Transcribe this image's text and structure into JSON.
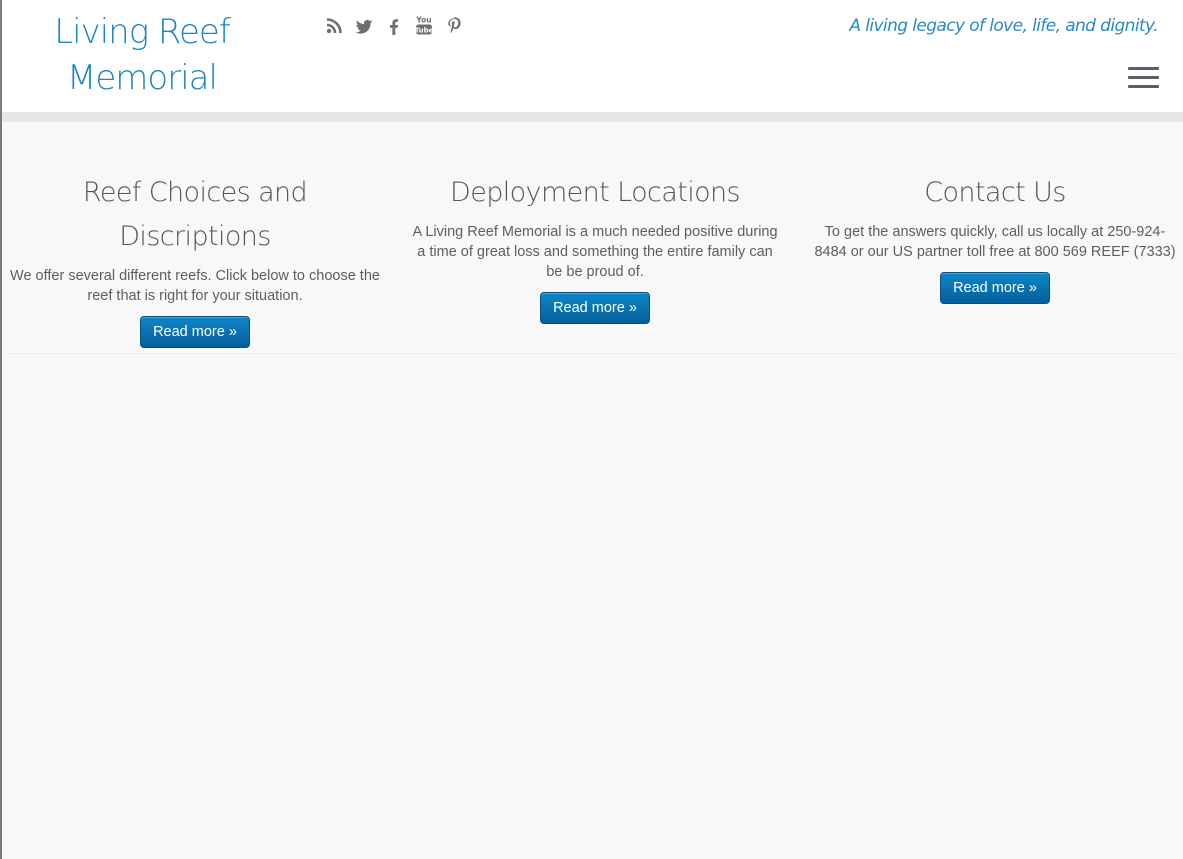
{
  "site": {
    "logo": "Living Reef Memorial",
    "tagline": "A living legacy of love, life, and dignity."
  },
  "social": [
    {
      "name": "rss-icon"
    },
    {
      "name": "twitter-icon"
    },
    {
      "name": "facebook-icon"
    },
    {
      "name": "youtube-icon"
    },
    {
      "name": "pinterest-icon"
    }
  ],
  "colors": {
    "brand_blue": "#1e84c4",
    "button": "#0a6fad",
    "background": "#f8f8f8"
  },
  "featured": [
    {
      "title": "Reef Choices and Discriptions",
      "text": "We offer several different reefs. Click below to choose the reef that is right for your situation.",
      "button": "Read more »"
    },
    {
      "title": "Deployment Locations",
      "text": "A Living Reef Memorial is a much needed positive during a time of great loss and something the entire family can be be proud of.",
      "button": "Read more »"
    },
    {
      "title": "Contact Us",
      "text": "To get the answers quickly, call us locally at 250-924-8484 or our US partner toll free at 800 569 REEF (7333)",
      "button": "Read more »"
    }
  ]
}
